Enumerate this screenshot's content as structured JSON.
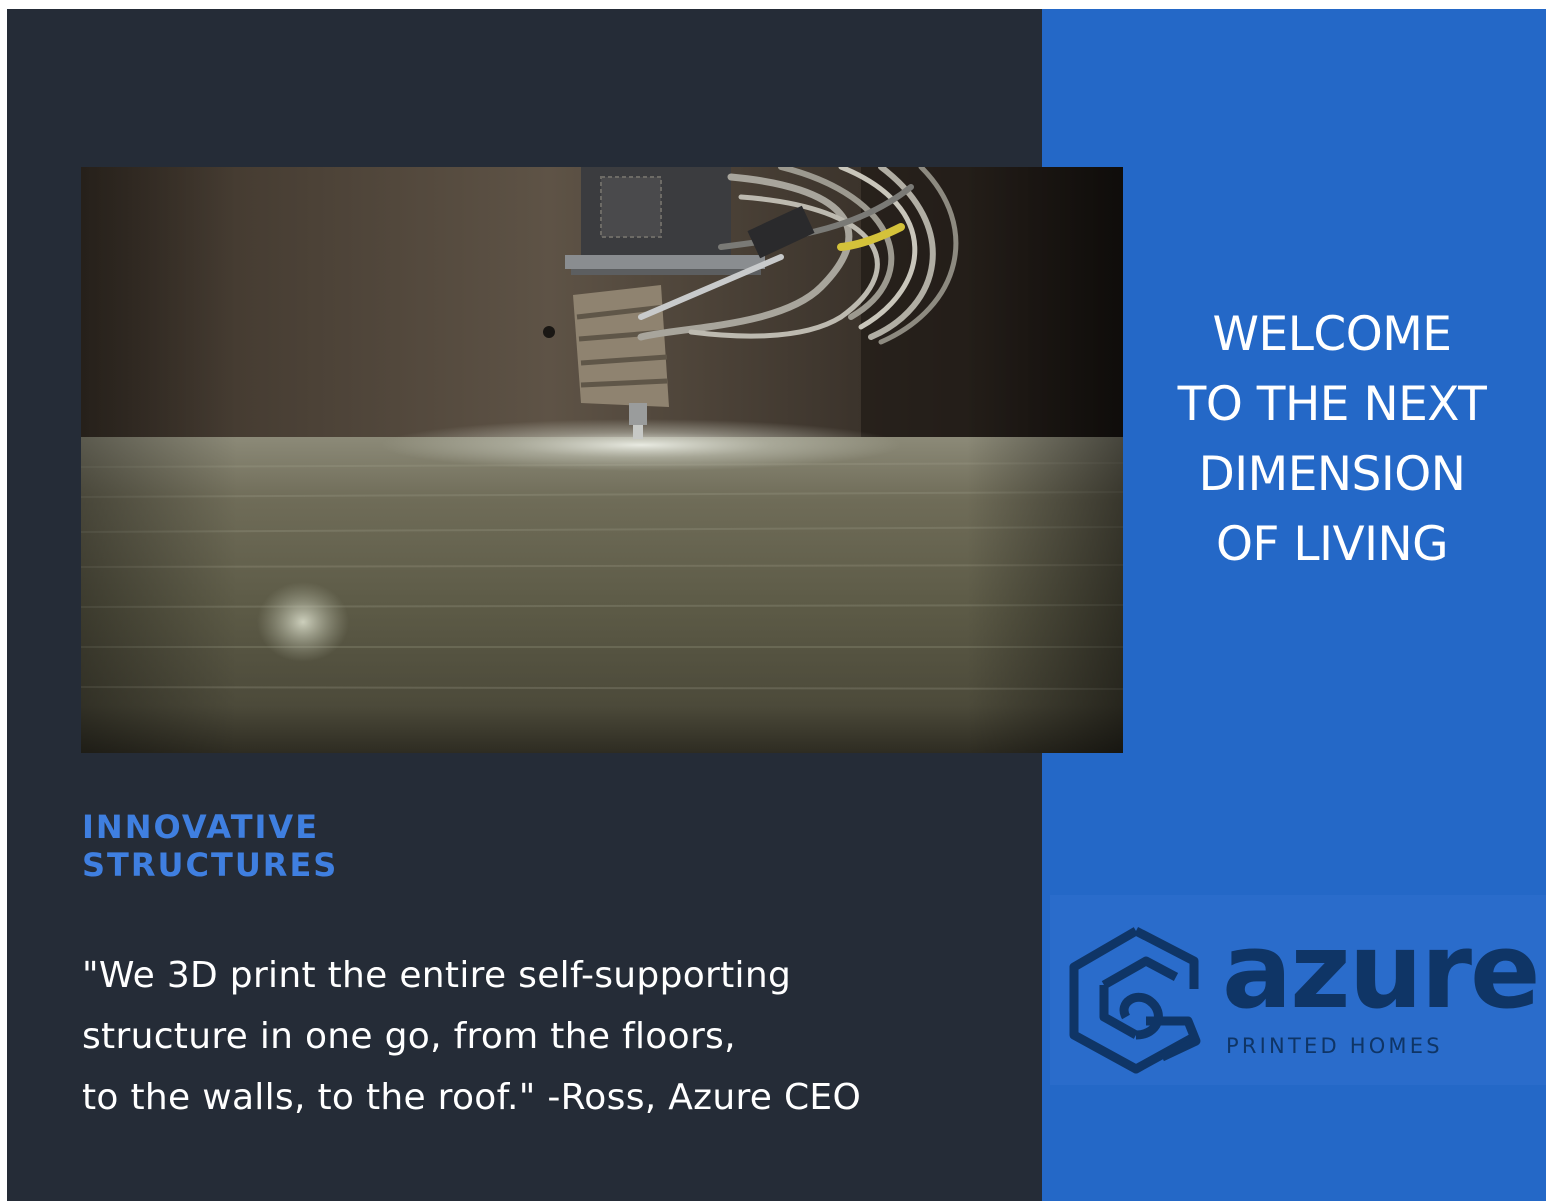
{
  "hero": {
    "headline": "WELCOME\nTO THE NEXT\nDIMENSION\nOF LIVING",
    "image": "3d-concrete-printer-nozzle-photo"
  },
  "feature": {
    "subheading": "INNOVATIVE\nSTRUCTURES",
    "quote": "\"We 3D print the entire self-supporting\nstructure in one go, from the floors,\nto the walls, to the roof.\" -Ross, Azure CEO"
  },
  "logo": {
    "wordmark": "azure",
    "tagline": "PRINTED HOMES",
    "icon": "printed-house-icon"
  },
  "colors": {
    "dark_panel": "#252c37",
    "blue_panel": "#2468c7",
    "accent_text": "#3f7fe0",
    "logo_navy": "#0f3566"
  }
}
